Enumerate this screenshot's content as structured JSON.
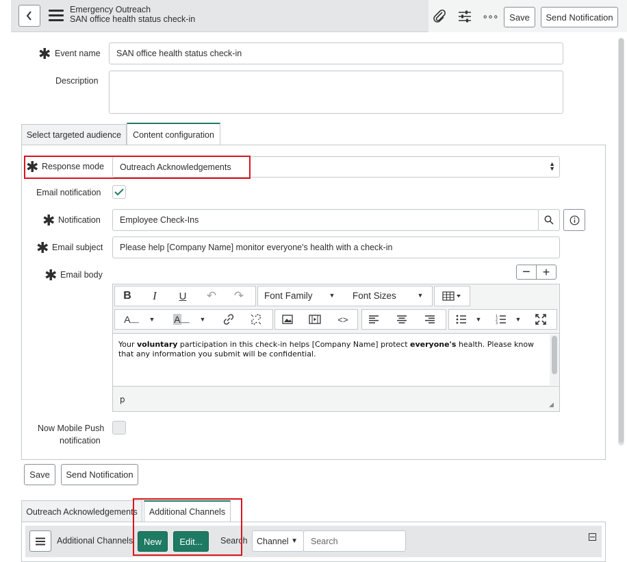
{
  "header": {
    "record_type": "Emergency Outreach",
    "record_name": "SAN office health status check-in",
    "save_label": "Save",
    "send_label": "Send Notification",
    "more_glyph": "∘∘∘"
  },
  "form": {
    "event_name_label": "Event name",
    "event_name_value": "SAN office health status check-in",
    "description_label": "Description",
    "description_value": ""
  },
  "tabs": [
    {
      "label": "Select targeted audience"
    },
    {
      "label": "Content configuration"
    }
  ],
  "content": {
    "response_mode_label": "Response mode",
    "response_mode_value": "Outreach Acknowledgements",
    "email_notification_label": "Email notification",
    "email_notification_checked": true,
    "notification_label": "Notification",
    "notification_value": "Employee Check-Ins",
    "email_subject_label": "Email subject",
    "email_subject_value": "Please help [Company Name] monitor everyone's health with a check-in",
    "email_body_label": "Email body",
    "body": {
      "t1": "Your ",
      "b1": "voluntary",
      "t2": " participation in this check-in helps [Company Name] protect ",
      "b2": "everyone's",
      "t3": " health. Please know that any information you submit will be confidential."
    },
    "status_path": "p",
    "mobile_push_label_1": "Now Mobile Push",
    "mobile_push_label_2": "notification",
    "mobile_push_checked": false
  },
  "editor": {
    "font_family": "Font Family",
    "font_sizes": "Font Sizes"
  },
  "footer": {
    "save_label": "Save",
    "send_label": "Send Notification"
  },
  "related": {
    "tabs": [
      {
        "label": "Outreach Acknowledgements"
      },
      {
        "label": "Additional Channels"
      }
    ],
    "list_title": "Additional Channels",
    "new_label": "New",
    "edit_label": "Edit...",
    "search_label": "Search",
    "search_field": "Channel",
    "search_placeholder": "Search"
  },
  "colors": {
    "accent": "#1f7a63",
    "highlight": "#d9141c"
  }
}
